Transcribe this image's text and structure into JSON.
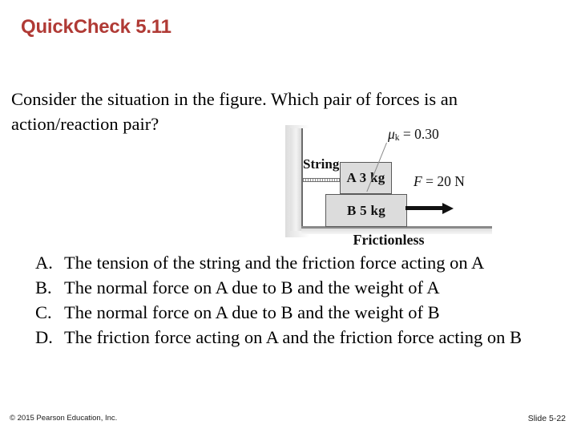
{
  "slide": {
    "title": "QuickCheck 5.11",
    "title_color": "#b03a35",
    "question": "Consider the situation in the figure. Which pair of forces is an action/reaction pair?"
  },
  "figure": {
    "caption_bottom": "Frictionless",
    "string_label": "String",
    "block_top_label": "A 3 kg",
    "block_bottom_label": "B 5 kg",
    "friction_coefficient_label": "μ",
    "friction_coefficient_sub": "k",
    "friction_coefficient_value": " = 0.30",
    "force_symbol": "F",
    "force_value": " = 20 N",
    "block_fill": "#dcdcdc",
    "block_stroke": "#5a5a5a"
  },
  "answers": [
    {
      "letter": "A.",
      "text": "The tension of the string and the friction force acting on A"
    },
    {
      "letter": "B.",
      "text": "The normal force on A due to B and the weight of A"
    },
    {
      "letter": "C.",
      "text": "The normal force on A due to B and the weight of B"
    },
    {
      "letter": "D.",
      "text": "The friction force acting on A and the friction force acting on B"
    }
  ],
  "footer": {
    "copyright": "© 2015 Pearson Education, Inc.",
    "slide_number": "Slide 5-22"
  }
}
